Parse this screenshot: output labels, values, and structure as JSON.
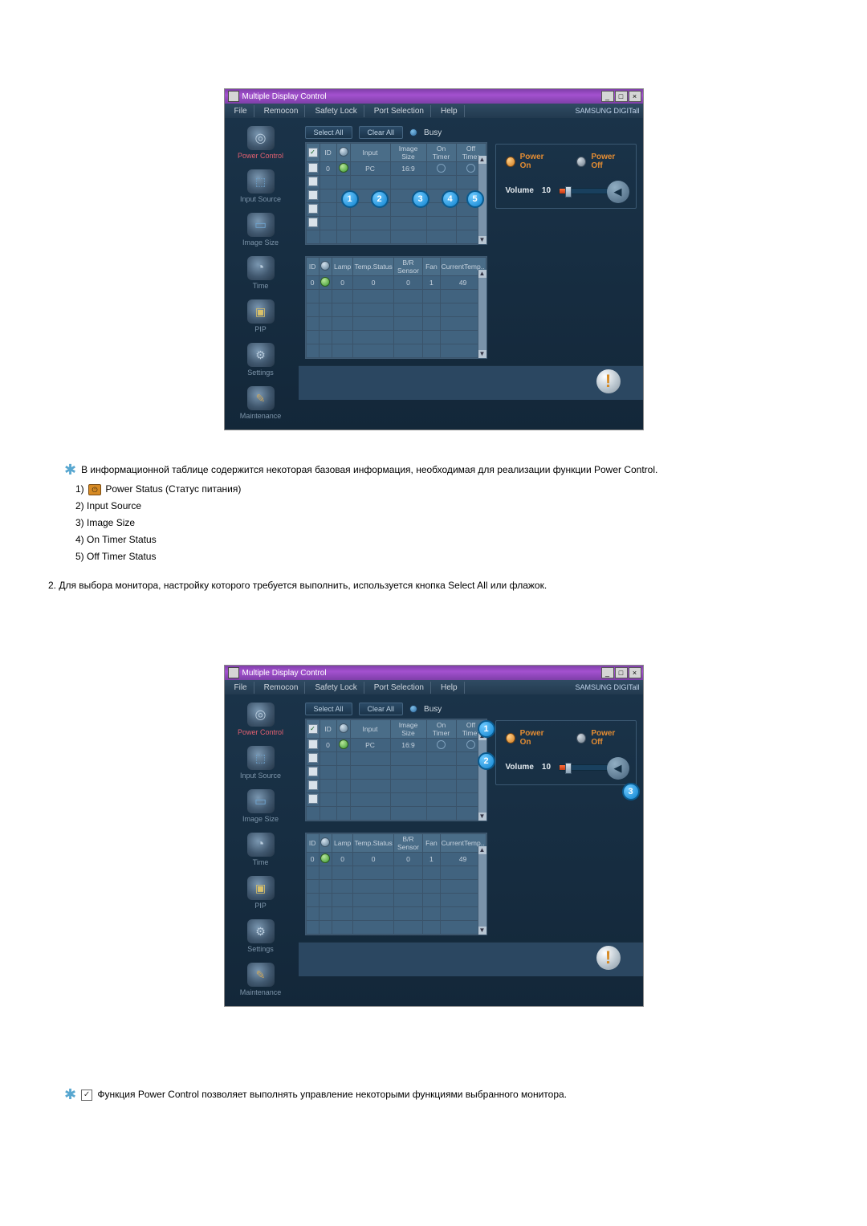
{
  "window": {
    "title": "Multiple Display Control",
    "brand": "SAMSUNG DIGITall"
  },
  "menu": {
    "file": "File",
    "remocon": "Remocon",
    "safety": "Safety Lock",
    "port": "Port Selection",
    "help": "Help"
  },
  "sidebar": {
    "power": "Power Control",
    "input": "Input Source",
    "image": "Image Size",
    "time": "Time",
    "pip": "PIP",
    "settings": "Settings",
    "maint": "Maintenance"
  },
  "toolbar": {
    "selectAll": "Select All",
    "clearAll": "Clear All",
    "busy": "Busy"
  },
  "grid": {
    "headers": {
      "chk": " ",
      "id": "ID",
      "status": " ",
      "input": "Input",
      "imageSize": "Image Size",
      "onTimer": "On Timer",
      "offTimer": "Off Timer"
    },
    "row0": {
      "id": "0",
      "input": "PC",
      "imageSize": "16:9"
    }
  },
  "grid2": {
    "headers": {
      "id": "ID",
      "status": " ",
      "lamp": "Lamp",
      "temp": "Temp.Status",
      "br": "B/R Sensor",
      "fan": "Fan",
      "currentTemp": "CurrentTemp.."
    },
    "row0": {
      "id": "0",
      "lamp": "0",
      "temp": "0",
      "br": "0",
      "fan": "1",
      "currentTemp": "49"
    }
  },
  "panel": {
    "powerOn": "Power On",
    "powerOff": "Power Off",
    "volumeLabel": "Volume",
    "volumeValue": "10"
  },
  "doc": {
    "intro": "В информационной таблице содержится некоторая базовая информация, необходимая для реализации функции Power Control.",
    "item1a": "1) ",
    "item1b": " Power Status (Статус питания)",
    "item2": "2) Input Source",
    "item3": "3) Image Size",
    "item4": "4) On Timer Status",
    "item5": "5) Off Timer Status",
    "instr2": "2.  Для выбора монитора, настройку которого требуется выполнить, используется кнопка Select All или флажок.",
    "footer": " Функция Power Control позволяет выполнять управление некоторыми функциями выбранного монитора."
  },
  "callouts": {
    "n1": "1",
    "n2": "2",
    "n3": "3",
    "n4": "4",
    "n5": "5"
  }
}
